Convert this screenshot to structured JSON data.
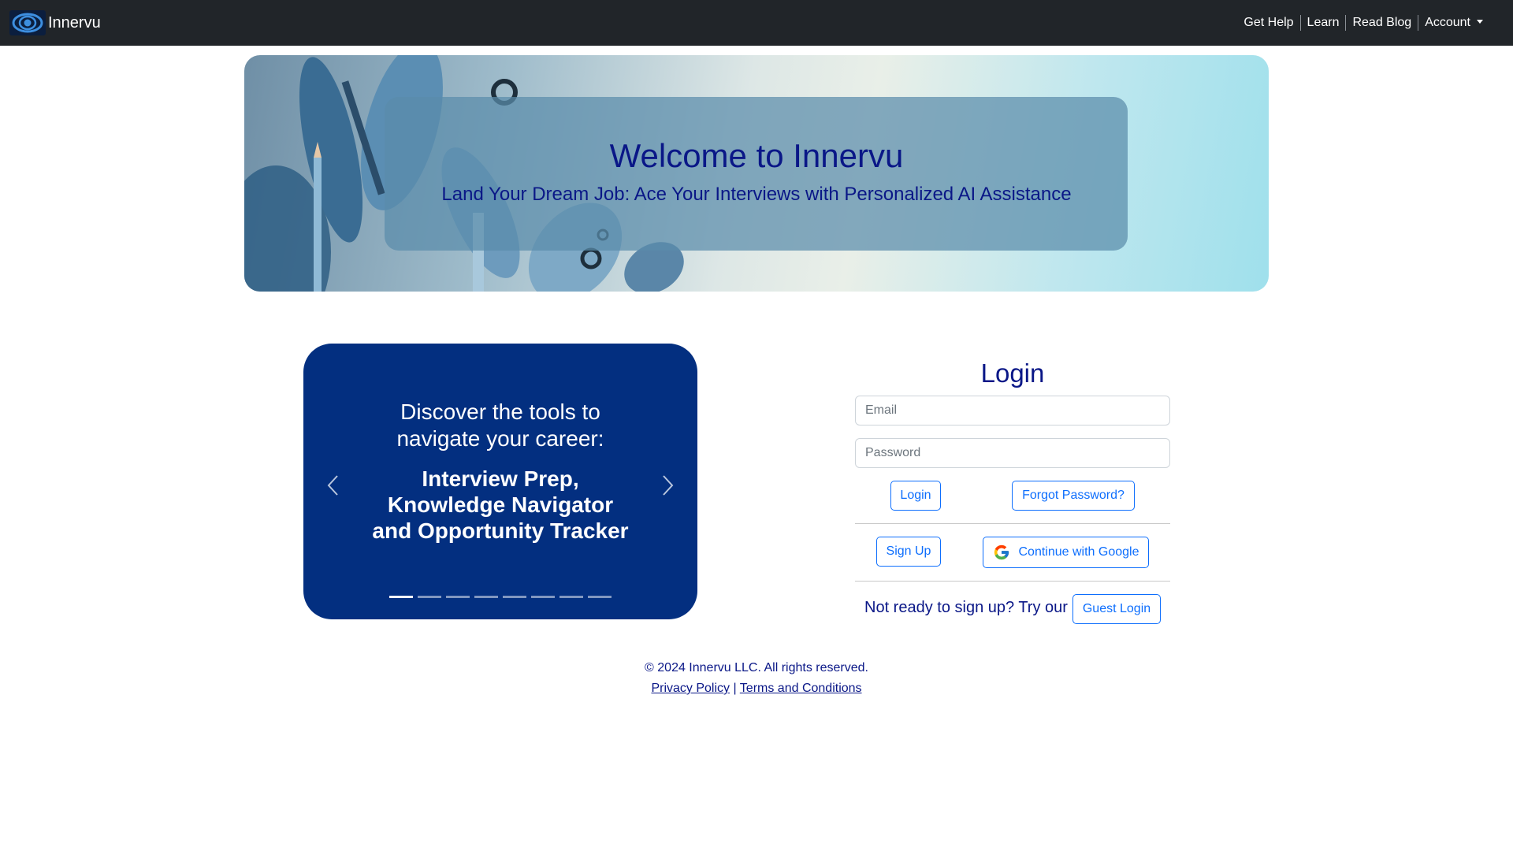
{
  "navbar": {
    "brand_name": "Innervu",
    "logo_icon": "eye-icon",
    "links": {
      "get_help": "Get Help",
      "learn": "Learn",
      "read_blog": "Read Blog",
      "account": "Account"
    }
  },
  "hero": {
    "title": "Welcome to Innervu",
    "subtitle": "Land Your Dream Job: Ace Your Interviews with Personalized AI Assistance"
  },
  "carousel": {
    "lead_line1": "Discover the tools to",
    "lead_line2": "navigate your career:",
    "bold_line1": "Interview Prep,",
    "bold_line2": "Knowledge Navigator",
    "bold_line3": "and Opportunity Tracker",
    "prev_icon": "chevron-left-icon",
    "next_icon": "chevron-right-icon",
    "slide_count": 8,
    "active_slide": 1,
    "background_color": "#032f80"
  },
  "login": {
    "title": "Login",
    "email_placeholder": "Email",
    "password_placeholder": "Password",
    "login_button": "Login",
    "forgot_button": "Forgot Password?",
    "signup_button": "Sign Up",
    "google_button": "Continue with Google",
    "google_icon": "google-icon",
    "guest_prompt": "Not ready to sign up? Try our",
    "guest_button": "Guest Login"
  },
  "footer": {
    "copyright": "© 2024 Innervu LLC. All rights reserved.",
    "privacy": "Privacy Policy",
    "separator": "|",
    "terms": "Terms and Conditions"
  },
  "colors": {
    "navbar": "#212529",
    "brand_text": "#0a1787",
    "button_blue": "#0d6efd"
  }
}
